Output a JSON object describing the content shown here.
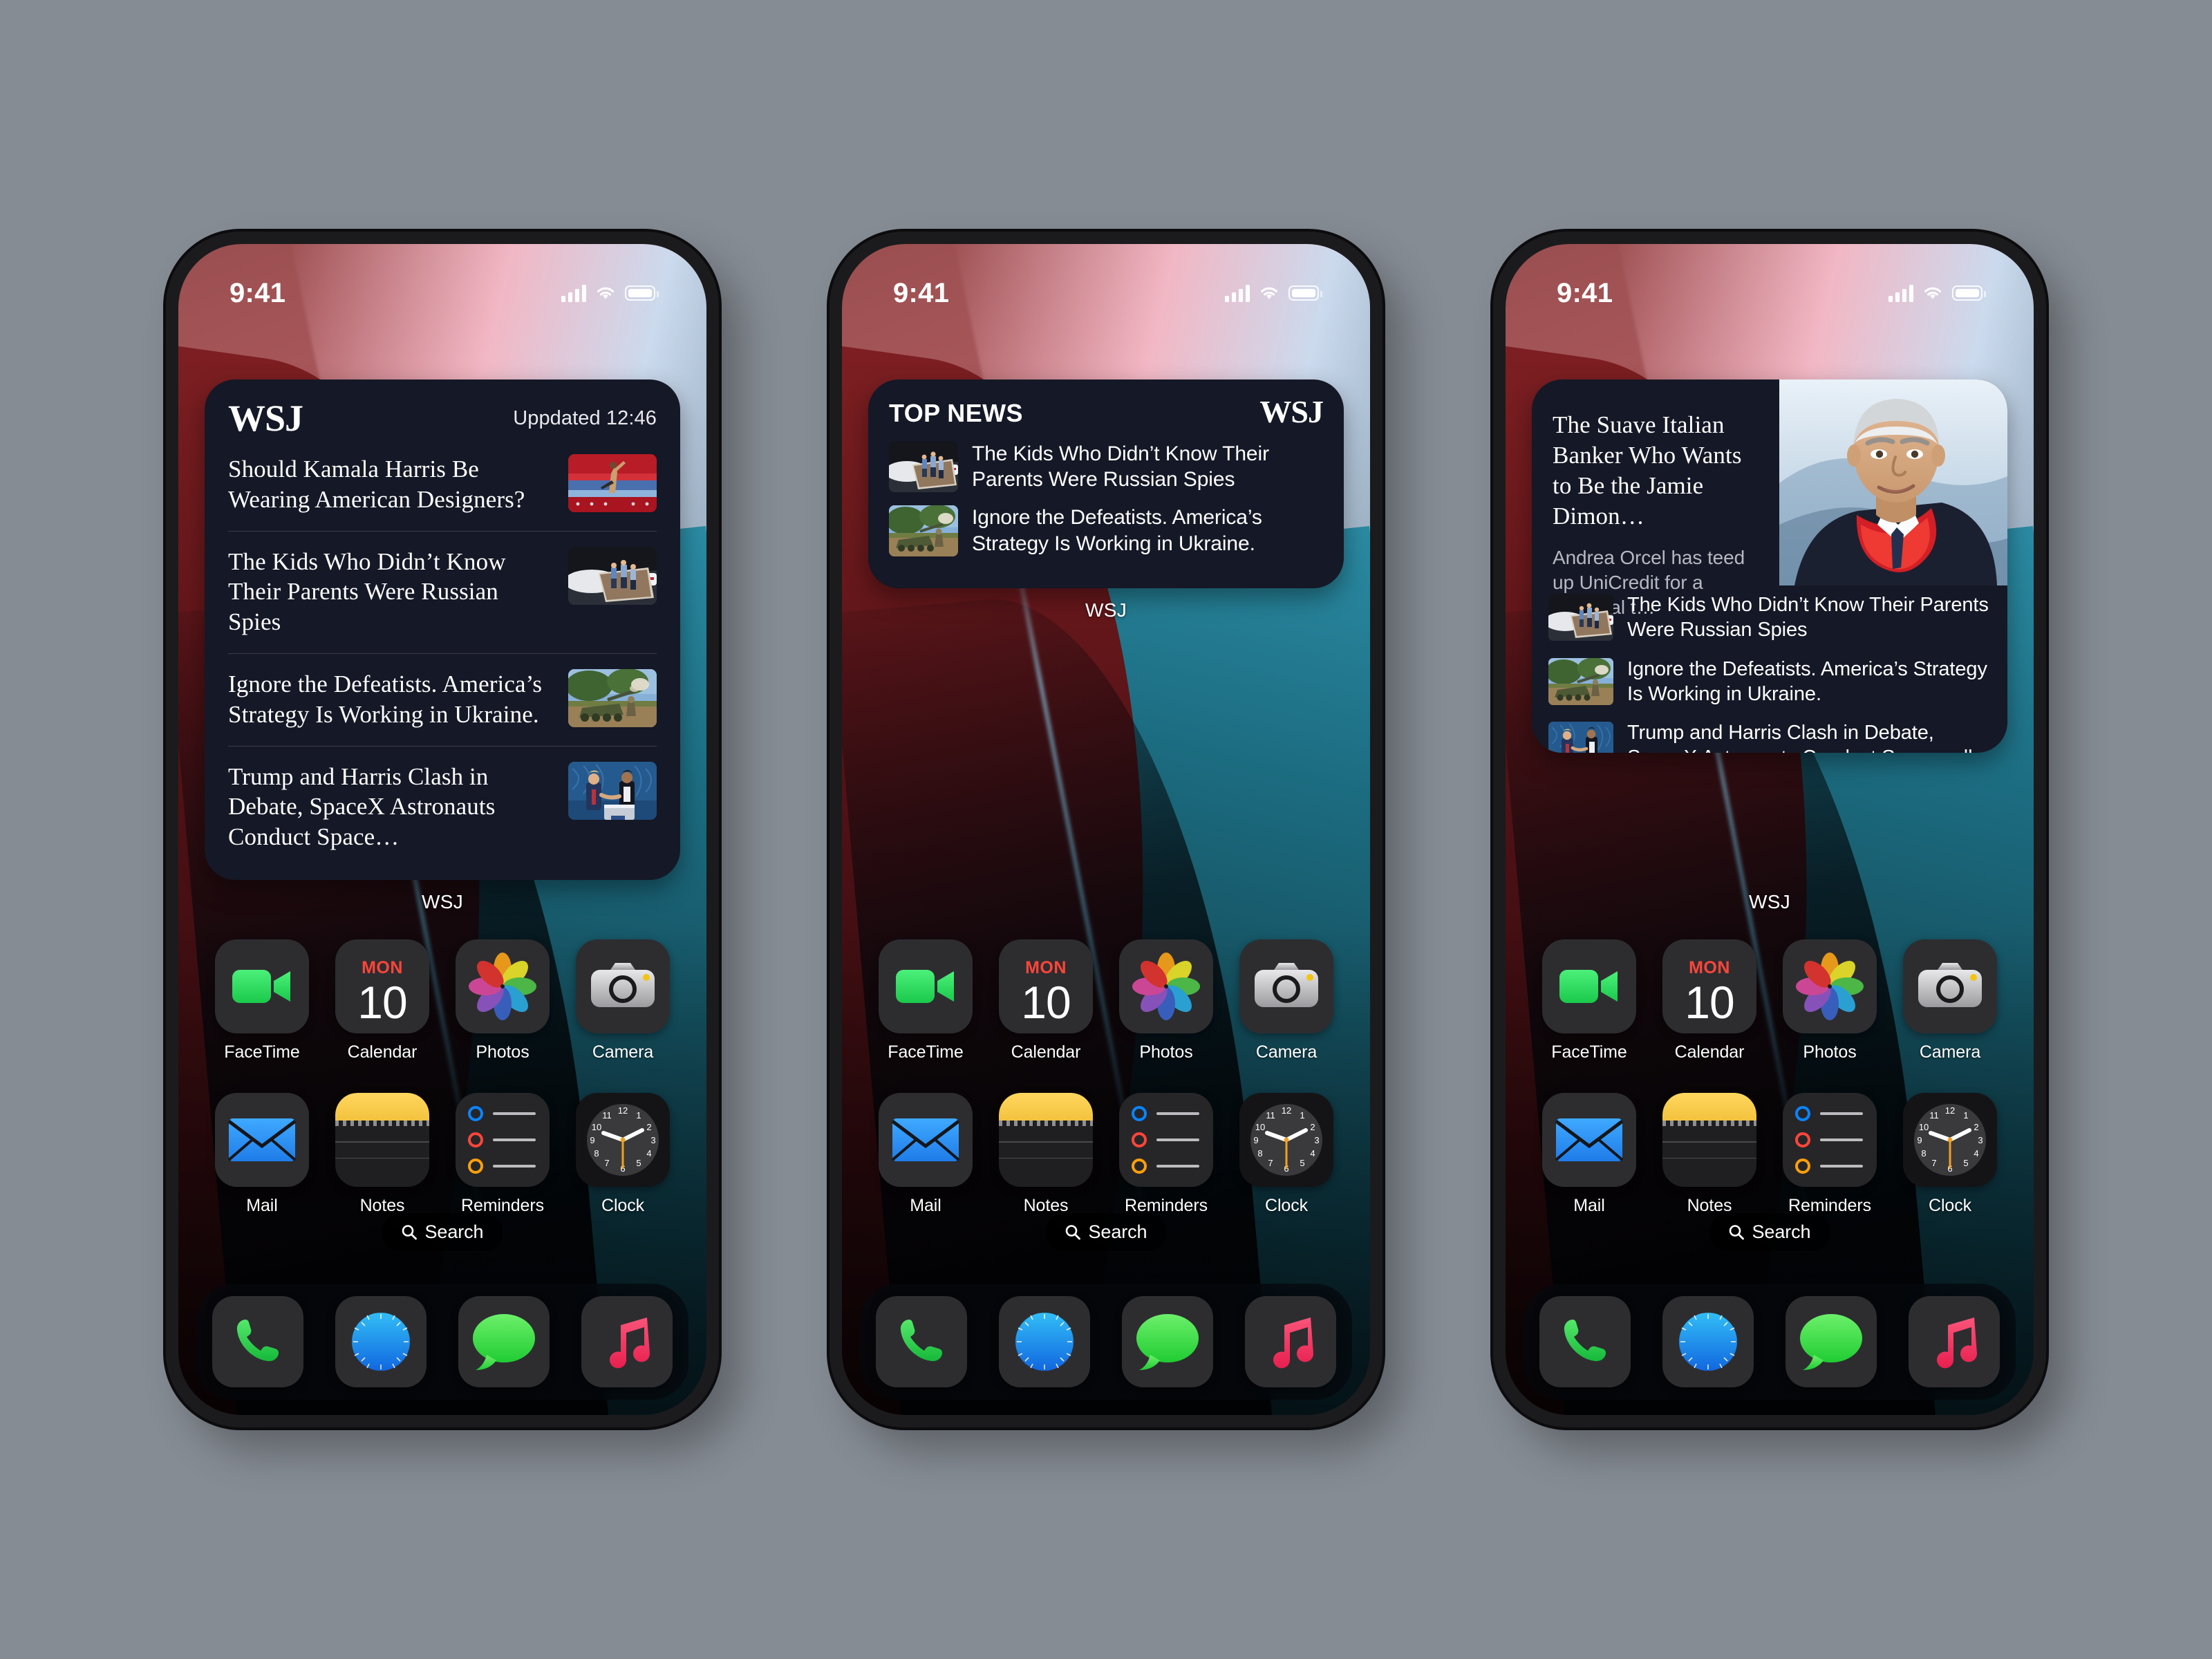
{
  "status_bar": {
    "time": "9:41",
    "signal_icon": "cellular-bars-icon",
    "wifi_icon": "wifi-icon",
    "battery_icon": "battery-icon"
  },
  "phones": [
    {
      "id": "phone-large-widget",
      "widget": {
        "style": "large-list",
        "brand": "WSJ",
        "updated_label": "Uppdated 12:46",
        "footer_label": "WSJ",
        "articles": [
          {
            "title": "Should Kamala Harris Be Wearing American Designers?",
            "thumb": "kamala-rally-thumb"
          },
          {
            "title": "The Kids Who Didn’t Know Their Parents Were Russian Spies",
            "thumb": "family-airstairs-thumb"
          },
          {
            "title": "Ignore the Defeatists. America’s Strategy Is Working in Ukraine.",
            "thumb": "artillery-thumb"
          },
          {
            "title": "Trump and Harris Clash in Debate, SpaceX Astronauts Conduct Space…",
            "thumb": "debate-thumb"
          }
        ]
      }
    },
    {
      "id": "phone-small-widget",
      "widget": {
        "style": "small-top-news",
        "brand": "WSJ",
        "section_label": "TOP NEWS",
        "footer_label": "WSJ",
        "articles": [
          {
            "title": "The Kids Who Didn’t Know Their Parents Were Russian Spies",
            "thumb": "family-airstairs-thumb"
          },
          {
            "title": "Ignore the Defeatists. America’s Strategy Is Working in Ukraine.",
            "thumb": "artillery-thumb"
          }
        ]
      }
    },
    {
      "id": "phone-feature-widget",
      "widget": {
        "style": "feature",
        "footer_label": "WSJ",
        "feature": {
          "headline": "The Suave Italian Banker Who Wants to Be the Jamie Dimon…",
          "deck": "Andrea Orcel has teed up UniCredit for a potential t…",
          "image": "andrea-orcel-portrait"
        },
        "articles": [
          {
            "title": "The Kids Who Didn’t Know Their Parents Were Russian Spies",
            "thumb": "family-airstairs-thumb"
          },
          {
            "title": "Ignore the Defeatists. America’s Strategy Is Working in Ukraine.",
            "thumb": "artillery-thumb"
          },
          {
            "title": "Trump and Harris Clash in Debate, SpaceX Astronauts Conduct Spacewalk",
            "thumb": "debate-thumb"
          }
        ]
      }
    }
  ],
  "home_screen": {
    "app_rows": [
      [
        {
          "label": "FaceTime",
          "icon": "facetime-icon"
        },
        {
          "label": "Calendar",
          "icon": "calendar-icon",
          "dow": "MON",
          "day": "10"
        },
        {
          "label": "Photos",
          "icon": "photos-icon"
        },
        {
          "label": "Camera",
          "icon": "camera-icon"
        }
      ],
      [
        {
          "label": "Mail",
          "icon": "mail-icon"
        },
        {
          "label": "Notes",
          "icon": "notes-icon"
        },
        {
          "label": "Reminders",
          "icon": "reminders-icon"
        },
        {
          "label": "Clock",
          "icon": "clock-icon"
        }
      ]
    ],
    "search": {
      "label": "Search",
      "icon": "search-icon"
    },
    "dock": [
      {
        "label": "Phone",
        "icon": "phone-icon"
      },
      {
        "label": "Safari",
        "icon": "safari-compass-icon"
      },
      {
        "label": "Messages",
        "icon": "messages-bubble-icon"
      },
      {
        "label": "Music",
        "icon": "music-note-icon"
      }
    ]
  },
  "colors": {
    "page_background": "#868c94",
    "widget_card": "#151826",
    "accent_red": "#ff453a",
    "accent_green": "#32d74b",
    "accent_blue": "#0a84ff",
    "accent_orange": "#ff9f0a"
  }
}
